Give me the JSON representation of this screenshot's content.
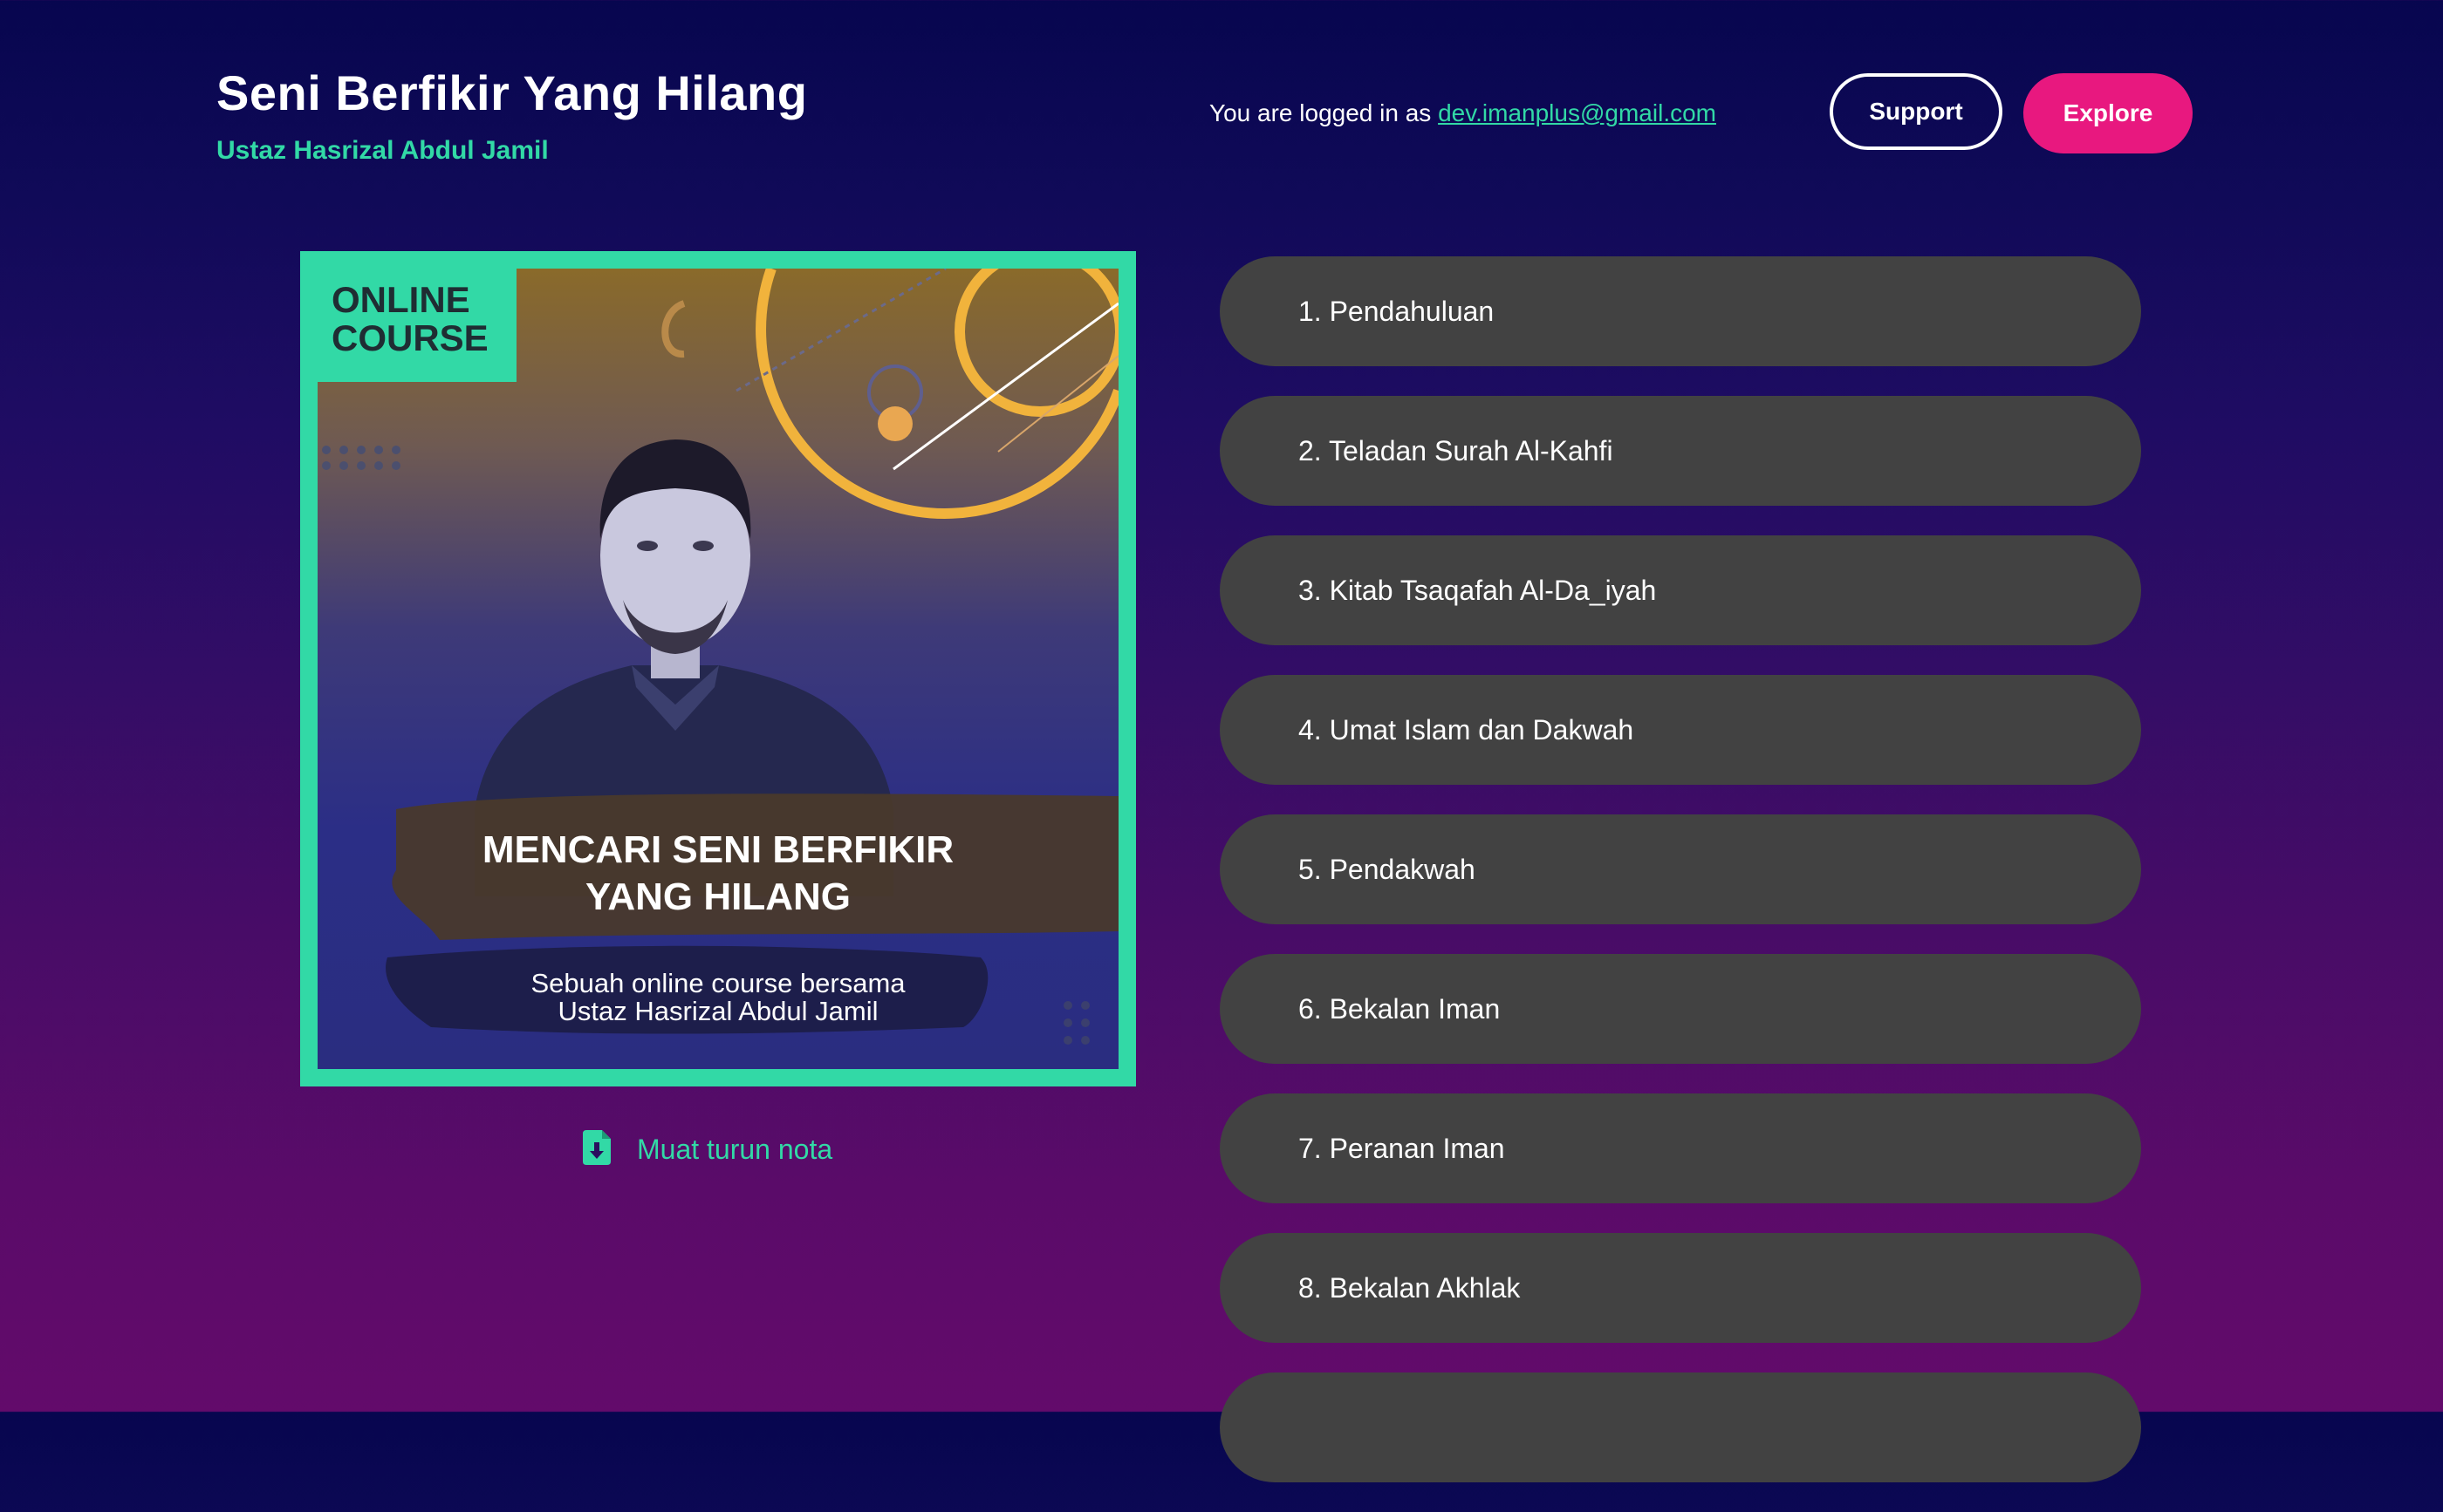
{
  "header": {
    "title": "Seni Berfikir Yang Hilang",
    "subtitle": "Ustaz Hasrizal Abdul Jamil",
    "login_prefix": "You are logged in as",
    "login_email": "dev.imanplus@gmail.com",
    "support_label": "Support",
    "explore_label": "Explore"
  },
  "cover": {
    "badge_line1": "ONLINE",
    "badge_line2": "COURSE",
    "headline_line1": "MENCARI SENI BERFIKIR",
    "headline_line2": "YANG HILANG",
    "sub_line1": "Sebuah online course bersama",
    "sub_line2": "Ustaz Hasrizal Abdul Jamil"
  },
  "download": {
    "label": "Muat turun nota",
    "icon": "file-download-icon"
  },
  "lessons": [
    {
      "label": "1. Pendahuluan"
    },
    {
      "label": "2. Teladan Surah Al-Kahfi"
    },
    {
      "label": "3. Kitab Tsaqafah Al-Da_iyah"
    },
    {
      "label": "4. Umat Islam dan Dakwah"
    },
    {
      "label": "5. Pendakwah"
    },
    {
      "label": "6. Bekalan Iman"
    },
    {
      "label": "7. Peranan Iman"
    },
    {
      "label": "8. Bekalan Akhlak"
    },
    {
      "label": ""
    }
  ],
  "colors": {
    "accent": "#32d9a6",
    "explore": "#e8187f",
    "lesson_bg": "#424242"
  }
}
